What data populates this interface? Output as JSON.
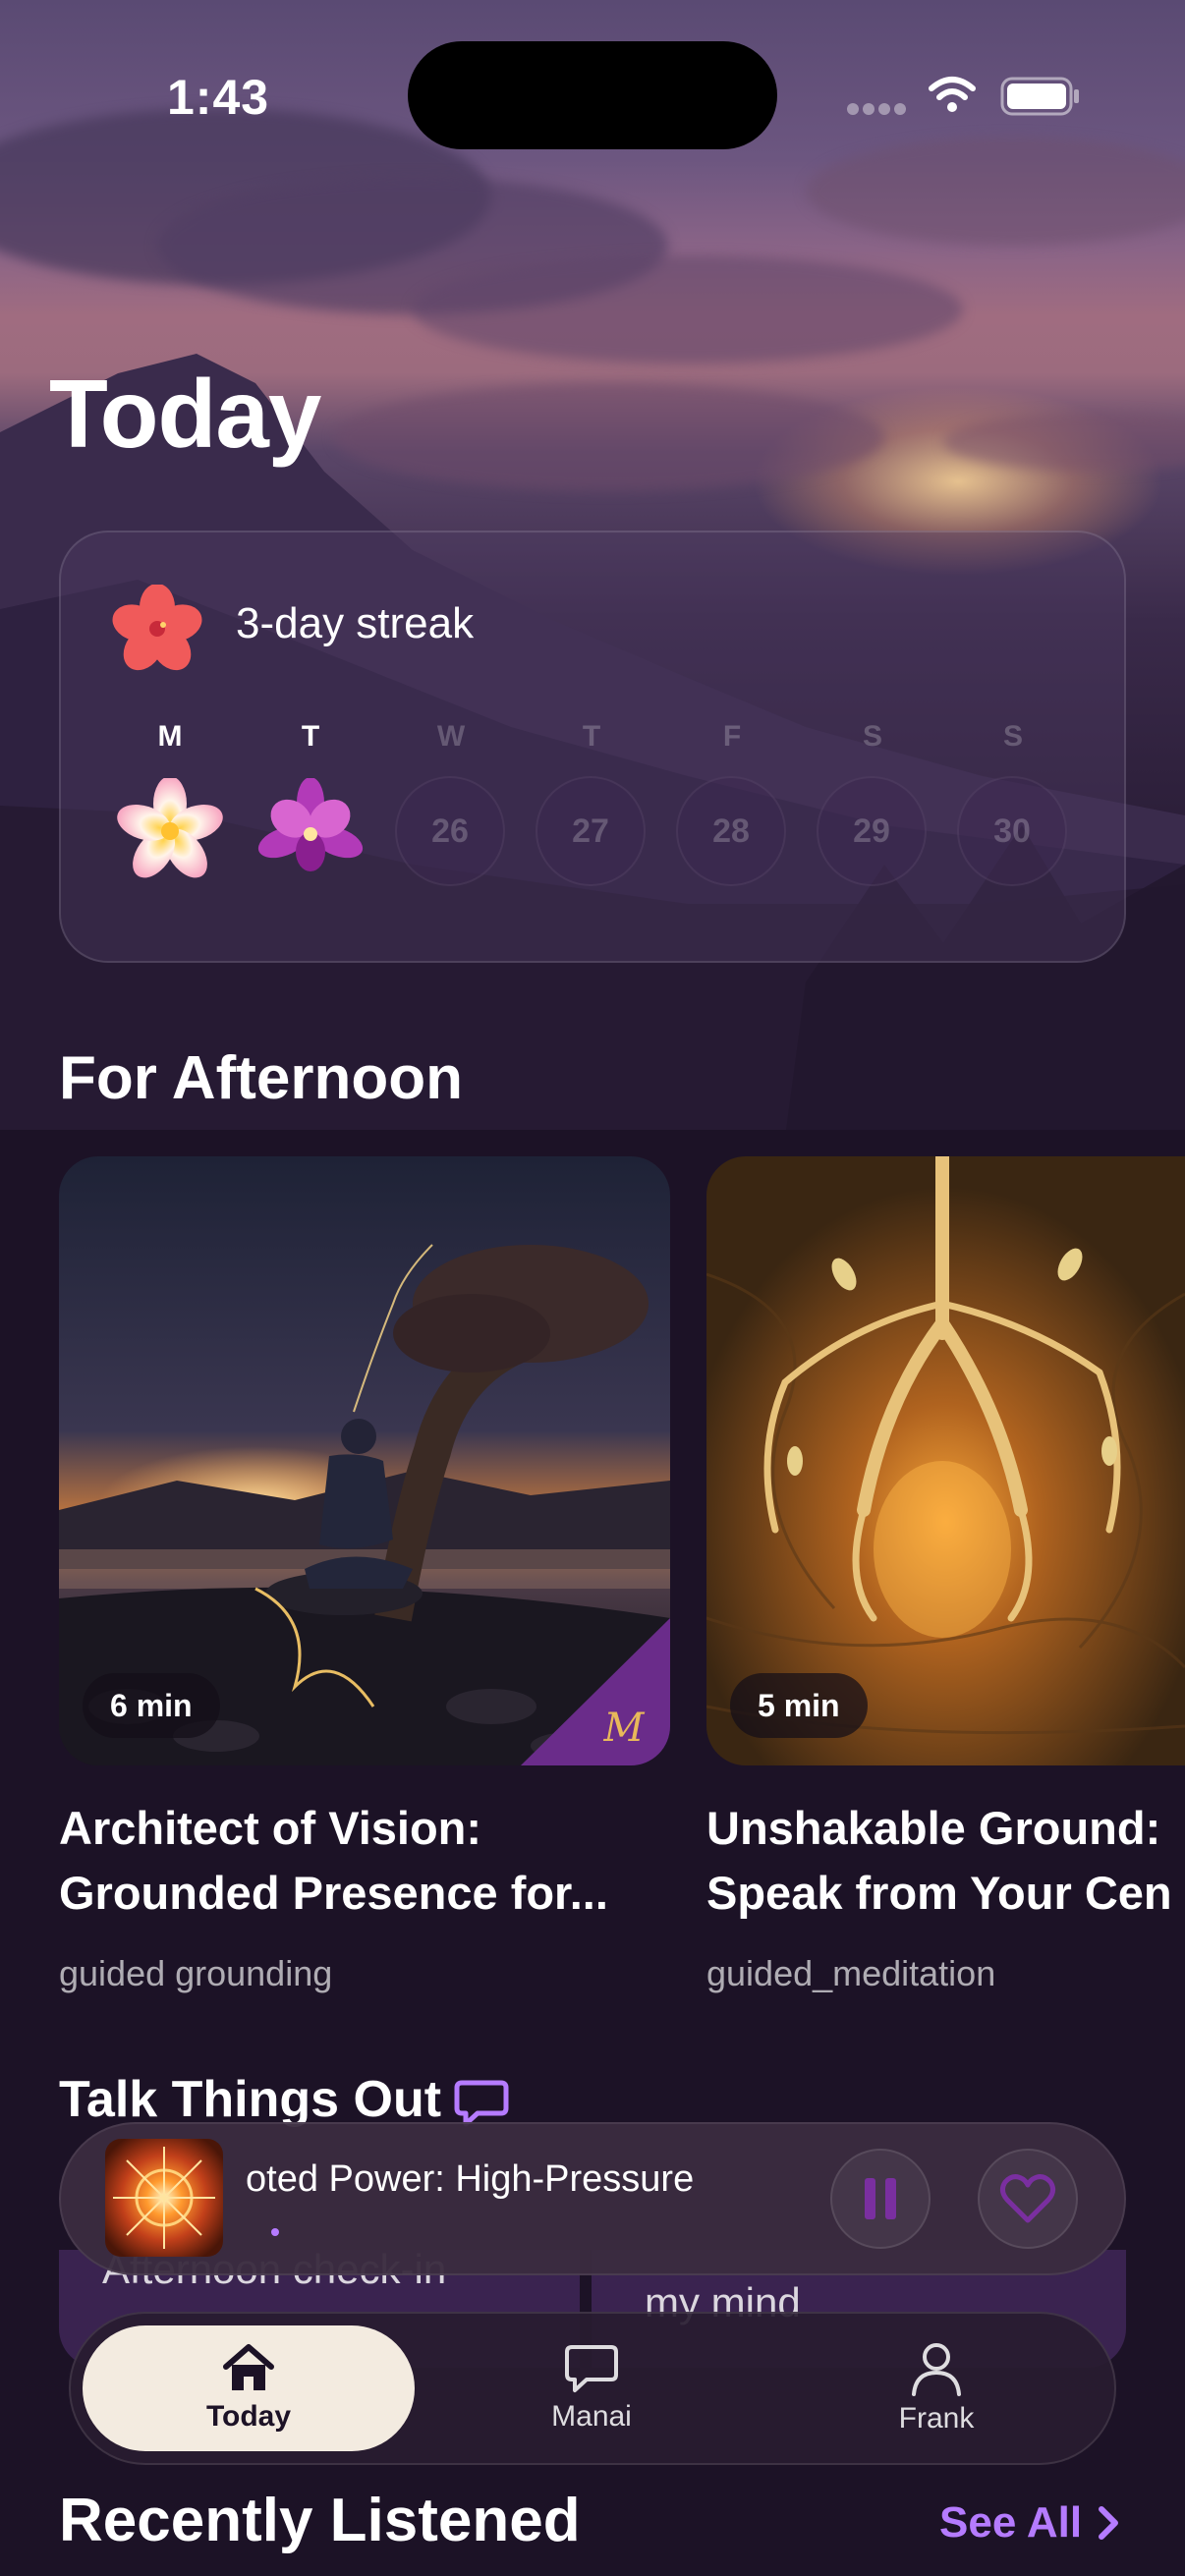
{
  "status_bar": {
    "time": "1:43"
  },
  "page": {
    "title": "Today"
  },
  "streak": {
    "label": "3-day streak",
    "days": [
      {
        "letter": "M",
        "date": "",
        "completed": true,
        "flower": "plumeria-icon"
      },
      {
        "letter": "T",
        "date": "",
        "completed": true,
        "flower": "orchid-icon"
      },
      {
        "letter": "W",
        "date": "26",
        "completed": false
      },
      {
        "letter": "T",
        "date": "27",
        "completed": false
      },
      {
        "letter": "F",
        "date": "28",
        "completed": false
      },
      {
        "letter": "S",
        "date": "29",
        "completed": false
      },
      {
        "letter": "S",
        "date": "30",
        "completed": false
      }
    ]
  },
  "for_afternoon": {
    "title": "For Afternoon",
    "cards": [
      {
        "duration": "6 min",
        "title_line1": "Architect of Vision:",
        "title_line2": "Grounded Presence for...",
        "subtitle": "guided grounding",
        "badge": "M"
      },
      {
        "duration": "5 min",
        "title_line1": "Unshakable Ground:",
        "title_line2": "Speak from Your Cen",
        "subtitle": "guided_meditation"
      }
    ]
  },
  "talk": {
    "title": "Talk Things Out",
    "items": [
      "Afternoon check-in",
      "my mind"
    ]
  },
  "player": {
    "title": "oted Power: High-Pressure",
    "progress": 0.01
  },
  "tabs": [
    {
      "label": "Today",
      "icon": "home-icon",
      "active": true
    },
    {
      "label": "Manai",
      "icon": "chat-bubble-icon",
      "active": false
    },
    {
      "label": "Frank",
      "icon": "person-icon",
      "active": false
    }
  ],
  "recently": {
    "title": "Recently Listened",
    "see_all": "See All"
  },
  "colors": {
    "accent": "#b57bff",
    "tab_active_bg": "#f3ebe0",
    "badge": "#6a2c8a"
  }
}
